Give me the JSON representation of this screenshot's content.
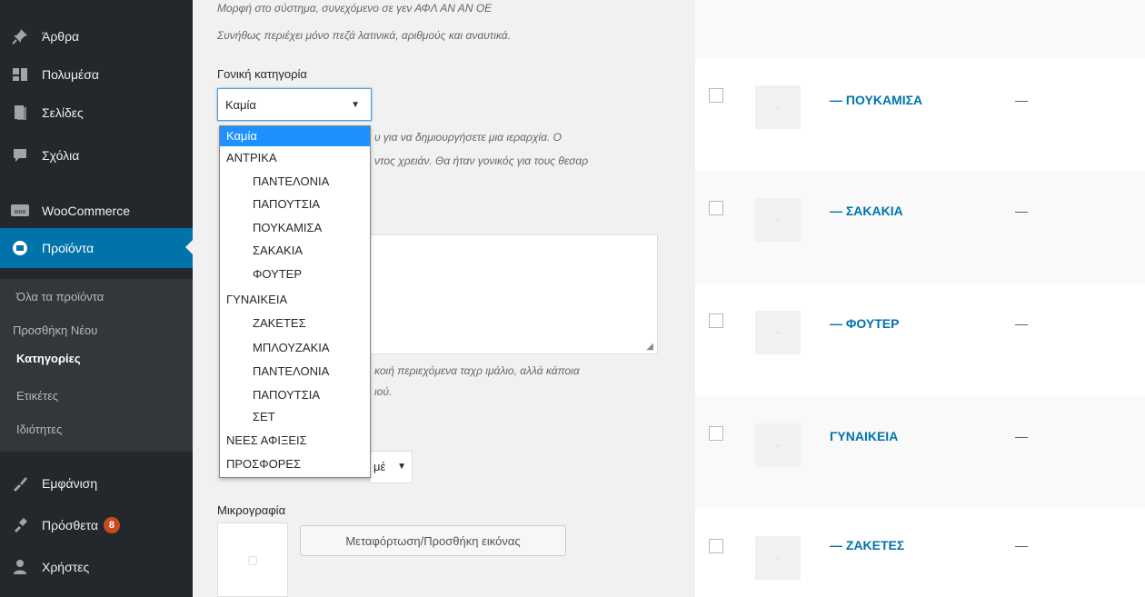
{
  "sidebar": {
    "items": [
      {
        "label": "Άρθρα",
        "icon": "pin-icon"
      },
      {
        "label": "Πολυμέσα",
        "icon": "media-icon"
      },
      {
        "label": "Σελίδες",
        "icon": "page-icon"
      },
      {
        "label": "Σχόλια",
        "icon": "comment-icon"
      },
      {
        "label": "WooCommerce",
        "icon": "woo-icon"
      },
      {
        "label": "Προϊόντα",
        "icon": "products-icon"
      },
      {
        "label": "Εμφάνιση",
        "icon": "appearance-icon"
      },
      {
        "label": "Πρόσθετα",
        "icon": "plugins-icon",
        "badge": "8"
      },
      {
        "label": "Χρήστες",
        "icon": "users-icon"
      }
    ],
    "submenu": [
      "Όλα τα προϊόντα",
      "Προσθήκη Νέου",
      "Κατηγορίες",
      "Ετικέτες",
      "Ιδιότητες"
    ]
  },
  "form": {
    "desc_top_1": "Μορφή στο σύστημα, συνεχόμενο σε γεν ΑΦΛ ΑΝ ΑΝ ΟΕ",
    "desc_top_2": "Συνήθως περιέχει μόνο πεζά λατινικά, αριθμούς και αναυτικά.",
    "parent_label": "Γονική κατηγορία",
    "select_value": "Καμία",
    "desc_mid_1": "υ για να δημιουργήσετε μια ιεραρχία. Ο",
    "desc_mid_2": "ντος χρειάν. Θα ήταν γονικός για τους θεσαρ",
    "desc_low_1": "κοιή περιεχόμενα ταχρ ιμάλιο, αλλά κάποια",
    "desc_low_2": "ιού.",
    "select2_value": "μέ",
    "thumbnail_label": "Μικρογραφία",
    "upload_label": "Μεταφόρτωση/Προσθήκη εικόνας"
  },
  "dropdown": {
    "options": [
      {
        "label": "Καμία",
        "level": 0,
        "selected": true
      },
      {
        "label": "ΑΝΤΡΙΚΑ",
        "level": 0
      },
      {
        "label": "ΠΑΝΤΕΛΟΝΙΑ",
        "level": 1
      },
      {
        "label": "ΠΑΠΟΥΤΣΙΑ",
        "level": 1
      },
      {
        "label": "ΠΟΥΚΑΜΙΣΑ",
        "level": 1
      },
      {
        "label": "ΣΑΚΑΚΙΑ",
        "level": 1
      },
      {
        "label": "ΦΟΥΤΕΡ",
        "level": 1
      },
      {
        "label": "ΓΥΝΑΙΚΕΙΑ",
        "level": 0
      },
      {
        "label": "ΖΑΚΕΤΕΣ",
        "level": 1
      },
      {
        "label": "ΜΠΛΟΥΖΑΚΙΑ",
        "level": 1
      },
      {
        "label": "ΠΑΝΤΕΛΟΝΙΑ",
        "level": 1
      },
      {
        "label": "ΠΑΠΟΥΤΣΙΑ",
        "level": 1
      },
      {
        "label": "ΣΕΤ",
        "level": 1
      },
      {
        "label": "ΝΕΕΣ ΑΦΙΞΕΙΣ",
        "level": 0
      },
      {
        "label": "ΠΡΟΣΦΟΡΕΣ",
        "level": 0
      }
    ]
  },
  "table": {
    "rows": [
      {
        "name": "— ΠΟΥΚΑΜΙΣΑ",
        "desc": "—"
      },
      {
        "name": "— ΣΑΚΑΚΙΑ",
        "desc": "—"
      },
      {
        "name": "— ΦΟΥΤΕΡ",
        "desc": "—"
      },
      {
        "name": "ΓΥΝΑΙΚΕΙΑ",
        "desc": "—"
      },
      {
        "name": "— ΖΑΚΕΤΕΣ",
        "desc": "—"
      }
    ]
  },
  "colors": {
    "sidebar_bg": "#23282d",
    "active_bg": "#0073aa",
    "link": "#0073aa",
    "dropdown_highlight": "#1e90ff",
    "badge": "#ca4a1f"
  }
}
